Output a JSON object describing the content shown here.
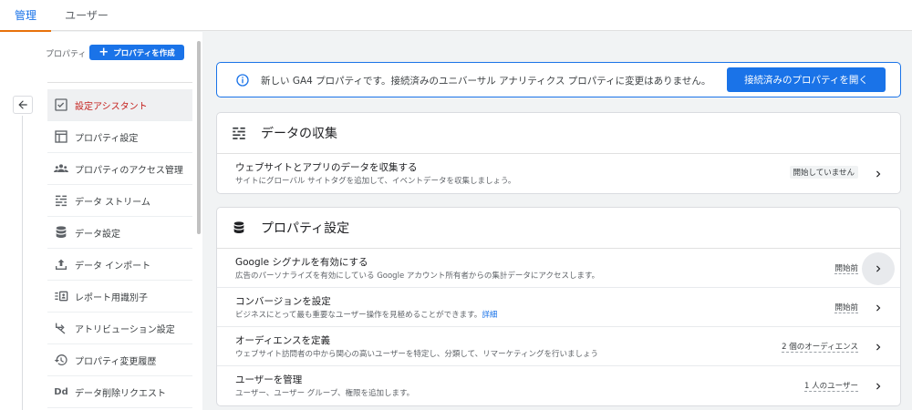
{
  "tabs": [
    {
      "label": "管理",
      "active": true
    },
    {
      "label": "ユーザー",
      "active": false
    }
  ],
  "sidebar": {
    "property_label": "プロパティ",
    "create_button": "プロパティを作成",
    "items": [
      {
        "label": "設定アシスタント",
        "icon": "checklist-icon",
        "active": true
      },
      {
        "label": "プロパティ設定",
        "icon": "property-settings-icon"
      },
      {
        "label": "プロパティのアクセス管理",
        "icon": "people-icon"
      },
      {
        "label": "データ ストリーム",
        "icon": "data-streams-icon"
      },
      {
        "label": "データ設定",
        "icon": "database-icon"
      },
      {
        "label": "データ インポート",
        "icon": "upload-icon"
      },
      {
        "label": "レポート用識別子",
        "icon": "identifier-icon"
      },
      {
        "label": "アトリビューション設定",
        "icon": "attribution-icon"
      },
      {
        "label": "プロパティ変更履歴",
        "icon": "history-icon"
      },
      {
        "label": "データ削除リクエスト",
        "icon": "data-deletion-icon"
      }
    ]
  },
  "banner": {
    "message": "新しい GA4 プロパティです。接続済みのユニバーサル アナリティクス プロパティに変更はありません。",
    "button": "接続済みのプロパティを開く"
  },
  "data_collection": {
    "title": "データの収集",
    "rows": [
      {
        "title": "ウェブサイトとアプリのデータを収集する",
        "desc": "サイトにグローバル サイトタグを追加して、イベントデータを収集しましょう。",
        "status": "開始していません"
      }
    ]
  },
  "property_settings": {
    "title": "プロパティ設定",
    "rows": [
      {
        "title": "Google シグナルを有効にする",
        "desc": "広告のパーソナライズを有効にしている Google アカウント所有者からの集計データにアクセスします。",
        "status": "開始前"
      },
      {
        "title": "コンバージョンを設定",
        "desc": "ビジネスにとって最も重要なユーザー操作を見極めることができます。",
        "desc_link": "詳細",
        "status": "開始前"
      },
      {
        "title": "オーディエンスを定義",
        "desc": "ウェブサイト訪問者の中から関心の高いユーザーを特定し、分類して、リマーケティングを行いましょう",
        "status": "2 個のオーディエンス"
      },
      {
        "title": "ユーザーを管理",
        "desc": "ユーザー、ユーザー グループ、権限を追加します。",
        "status": "1 人のユーザー"
      }
    ]
  },
  "colors": {
    "accent": "#1a73e8",
    "active_text": "#c5221f",
    "tab_indicator": "#e8710a"
  }
}
